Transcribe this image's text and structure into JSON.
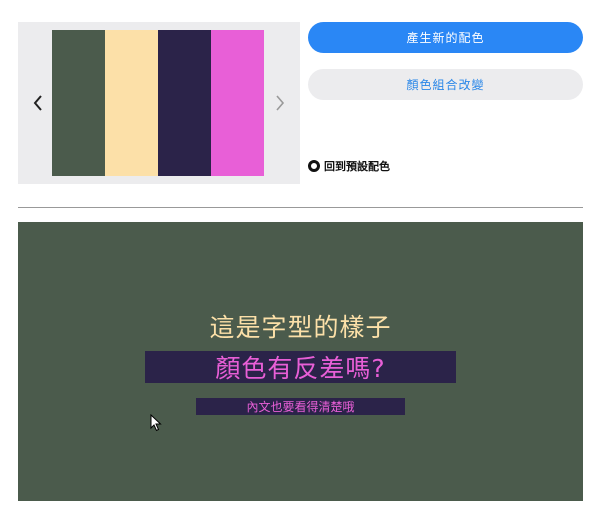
{
  "palette": {
    "swatches": [
      {
        "color": "#4b5b4c"
      },
      {
        "color": "#fce0a8"
      },
      {
        "color": "#2b2349"
      },
      {
        "color": "#e85fd7"
      }
    ],
    "prev_icon": "chevron-left-icon",
    "next_icon": "chevron-right-icon"
  },
  "actions": {
    "generate_label": "產生新的配色",
    "generate_color": "#2a87f5",
    "rearrange_label": "顏色組合改變",
    "rearrange_bg": "#ececee",
    "reset_label": "回到預設配色"
  },
  "preview": {
    "background": "#4b5b4c",
    "title": "這是字型的樣子",
    "title_color": "#fce0a8",
    "subtitle": "顏色有反差嗎?",
    "subtitle_color": "#e85fd7",
    "subtitle_bg": "#2b2349",
    "body": "內文也要看得清楚哦",
    "body_color": "#e85fd7",
    "body_bg": "#2b2349"
  }
}
